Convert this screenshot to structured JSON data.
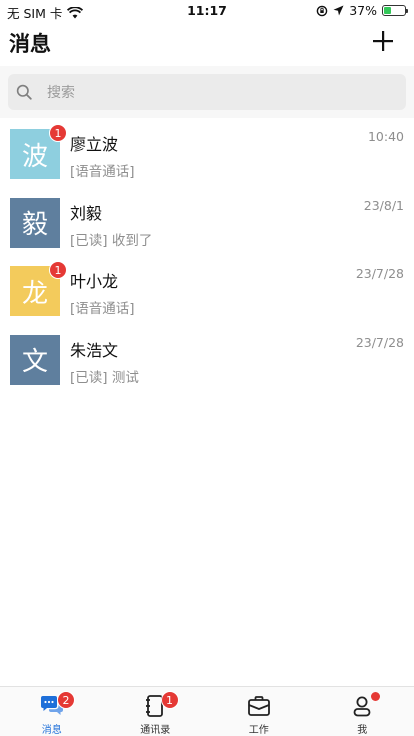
{
  "status_bar": {
    "carrier": "无 SIM 卡",
    "time": "11:17",
    "battery": "37%",
    "battery_level": 0.37
  },
  "header": {
    "title": "消息",
    "add_icon": "plus-icon"
  },
  "search": {
    "placeholder": "搜索",
    "icon": "search-icon"
  },
  "chats": [
    {
      "avatar_char": "波",
      "avatar_color": "#8ecfdf",
      "name": "廖立波",
      "time": "10:40",
      "preview": "[语音通话]",
      "unread": "1"
    },
    {
      "avatar_char": "毅",
      "avatar_color": "#5f7f9e",
      "name": "刘毅",
      "time": "23/8/1",
      "preview": "[已读] 收到了",
      "unread": ""
    },
    {
      "avatar_char": "龙",
      "avatar_color": "#f3cb5c",
      "name": "叶小龙",
      "time": "23/7/28",
      "preview": "[语音通话]",
      "unread": "1"
    },
    {
      "avatar_char": "文",
      "avatar_color": "#5f7f9e",
      "name": "朱浩文",
      "time": "23/7/28",
      "preview": "[已读] 测试",
      "unread": ""
    }
  ],
  "tab_bar": {
    "accent": "#1e6fd9",
    "badge_color": "#e53935",
    "tabs": [
      {
        "label": "消息",
        "icon": "chat-bubbles-icon",
        "badge": "2",
        "active": true
      },
      {
        "label": "通讯录",
        "icon": "contacts-book-icon",
        "badge": "1",
        "active": false
      },
      {
        "label": "工作",
        "icon": "briefcase-icon",
        "badge": "",
        "active": false
      },
      {
        "label": "我",
        "icon": "person-icon",
        "badge": "",
        "dot": true,
        "active": false
      }
    ]
  }
}
